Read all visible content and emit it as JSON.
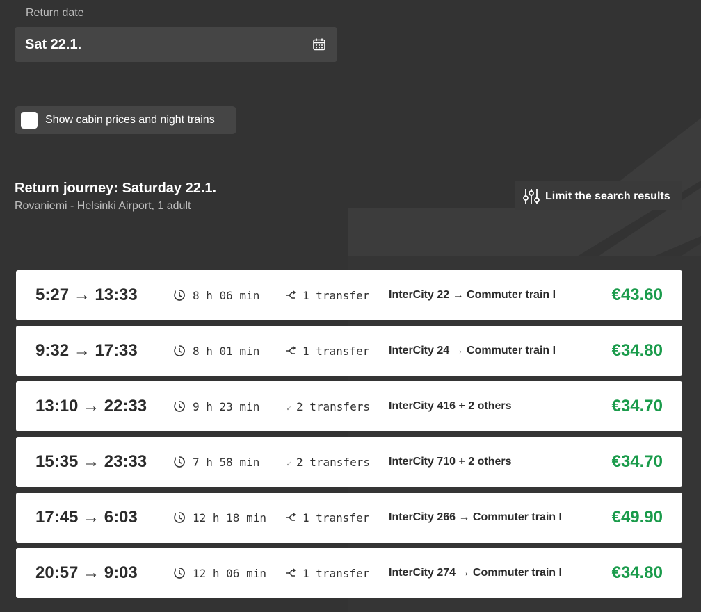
{
  "return_date": {
    "label": "Return date",
    "value": "Sat 22.1."
  },
  "options": {
    "show_cabin_label": "Show cabin prices and night trains",
    "show_cabin_checked": false
  },
  "journey": {
    "title": "Return journey: Saturday 22.1.",
    "subtitle": "Rovaniemi - Helsinki Airport, 1 adult"
  },
  "filter": {
    "limit_label": "Limit the search results"
  },
  "colors": {
    "background": "#333333",
    "field": "#454545",
    "price": "#1a9b4b"
  },
  "results": [
    {
      "times": "5:27 → 13:33",
      "duration": "8 h 06 min",
      "transfers": "1 transfer",
      "trains": "InterCity 22 → Commuter train I",
      "price": "€43.60"
    },
    {
      "times": "9:32 → 17:33",
      "duration": "8 h 01 min",
      "transfers": "1 transfer",
      "trains": "InterCity 24 → Commuter train I",
      "price": "€34.80"
    },
    {
      "times": "13:10 → 22:33",
      "duration": "9 h 23 min",
      "transfers": "2 transfers",
      "trains": "InterCity 416 + 2 others",
      "price": "€34.70"
    },
    {
      "times": "15:35 → 23:33",
      "duration": "7 h 58 min",
      "transfers": "2 transfers",
      "trains": "InterCity 710 + 2 others",
      "price": "€34.70"
    },
    {
      "times": "17:45 → 6:03",
      "duration": "12 h 18 min",
      "transfers": "1 transfer",
      "trains": "InterCity 266 → Commuter train I",
      "price": "€49.90"
    },
    {
      "times": "20:57 → 9:03",
      "duration": "12 h 06 min",
      "transfers": "1 transfer",
      "trains": "InterCity 274 → Commuter train I",
      "price": "€34.80"
    }
  ]
}
